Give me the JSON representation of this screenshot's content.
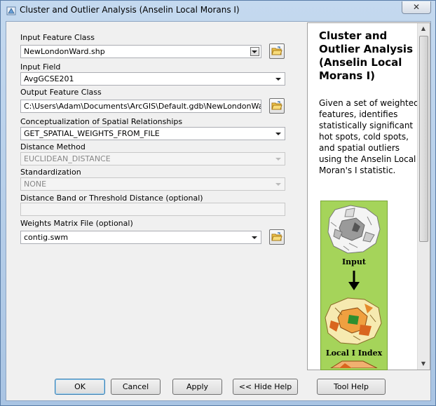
{
  "window": {
    "title": "Cluster and Outlier Analysis (Anselin Local Morans I)",
    "close_symbol": "✕"
  },
  "form": {
    "input_feature_class": {
      "label": "Input Feature Class",
      "value": "NewLondonWard.shp"
    },
    "input_field": {
      "label": "Input Field",
      "value": "AvgGCSE201"
    },
    "output_feature_class": {
      "label": "Output Feature Class",
      "value": "C:\\Users\\Adam\\Documents\\ArcGIS\\Default.gdb\\NewLondonWard_Clus"
    },
    "conceptualization": {
      "label": "Conceptualization of Spatial Relationships",
      "value": "GET_SPATIAL_WEIGHTS_FROM_FILE"
    },
    "distance_method": {
      "label": "Distance Method",
      "value": "EUCLIDEAN_DISTANCE"
    },
    "standardization": {
      "label": "Standardization",
      "value": "NONE"
    },
    "distance_band": {
      "label": "Distance Band or Threshold Distance (optional)",
      "value": ""
    },
    "weights_matrix": {
      "label": "Weights Matrix File (optional)",
      "value": "contig.swm"
    }
  },
  "help": {
    "title": "Cluster and Outlier Analysis (Anselin Local Morans I)",
    "description": "Given a set of weighted features, identifies statistically significant hot spots, cold spots, and spatial outliers using the Anselin Local Moran's I statistic.",
    "diagram_input_label": "Input",
    "diagram_output_label": "Local I Index"
  },
  "buttons": {
    "ok": "OK",
    "cancel": "Cancel",
    "apply": "Apply",
    "hide_help": "<< Hide Help",
    "tool_help": "Tool Help"
  },
  "colors": {
    "diagram_background": "#a5d45a",
    "hot_spot": "#d9661e",
    "accent": "#3c7fb1"
  }
}
